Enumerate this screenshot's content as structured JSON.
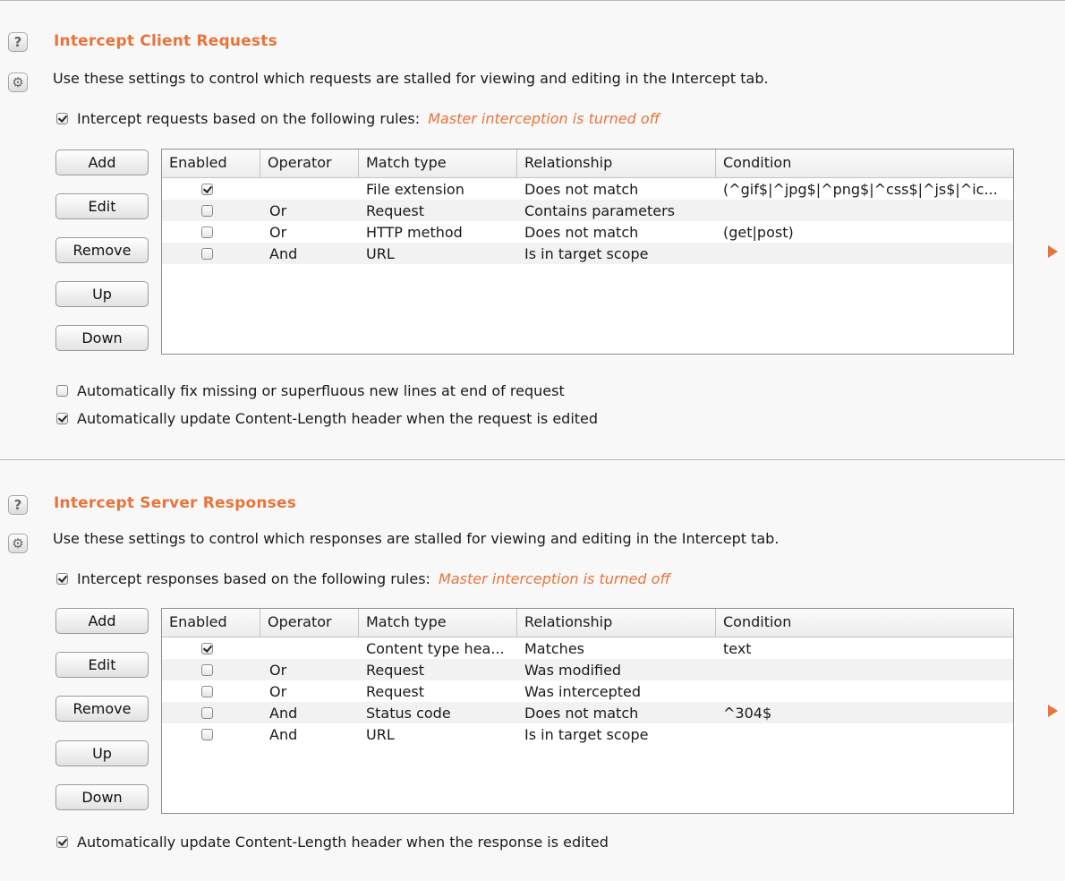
{
  "client": {
    "title": "Intercept Client Requests",
    "description": "Use these settings to control which requests are stalled for viewing and editing in the Intercept tab.",
    "master_label": "Intercept requests based on the following rules:",
    "master_checked": true,
    "master_status": "Master interception is turned off",
    "buttons": [
      "Add",
      "Edit",
      "Remove",
      "Up",
      "Down"
    ],
    "columns": [
      "Enabled",
      "Operator",
      "Match type",
      "Relationship",
      "Condition"
    ],
    "rows": [
      {
        "enabled": true,
        "operator": "",
        "match_type": "File extension",
        "relationship": "Does not match",
        "condition": "(^gif$|^jpg$|^png$|^css$|^js$|^ic..."
      },
      {
        "enabled": false,
        "operator": "Or",
        "match_type": "Request",
        "relationship": "Contains parameters",
        "condition": ""
      },
      {
        "enabled": false,
        "operator": "Or",
        "match_type": "HTTP method",
        "relationship": "Does not match",
        "condition": "(get|post)"
      },
      {
        "enabled": false,
        "operator": "And",
        "match_type": "URL",
        "relationship": "Is in target scope",
        "condition": ""
      }
    ],
    "options": [
      {
        "label": "Automatically fix missing or superfluous new lines at end of request",
        "checked": false
      },
      {
        "label": "Automatically update Content-Length header when the request is edited",
        "checked": true
      }
    ]
  },
  "server": {
    "title": "Intercept Server Responses",
    "description": "Use these settings to control which responses are stalled for viewing and editing in the Intercept tab.",
    "master_label": "Intercept responses based on the following rules:",
    "master_checked": true,
    "master_status": "Master interception is turned off",
    "buttons": [
      "Add",
      "Edit",
      "Remove",
      "Up",
      "Down"
    ],
    "columns": [
      "Enabled",
      "Operator",
      "Match type",
      "Relationship",
      "Condition"
    ],
    "rows": [
      {
        "enabled": true,
        "operator": "",
        "match_type": "Content type hea...",
        "relationship": "Matches",
        "condition": "text"
      },
      {
        "enabled": false,
        "operator": "Or",
        "match_type": "Request",
        "relationship": "Was modified",
        "condition": ""
      },
      {
        "enabled": false,
        "operator": "Or",
        "match_type": "Request",
        "relationship": "Was intercepted",
        "condition": ""
      },
      {
        "enabled": false,
        "operator": "And",
        "match_type": "Status code",
        "relationship": "Does not match",
        "condition": "^304$"
      },
      {
        "enabled": false,
        "operator": "And",
        "match_type": "URL",
        "relationship": "Is in target scope",
        "condition": ""
      }
    ],
    "options": [
      {
        "label": "Automatically update Content-Length header when the response is edited",
        "checked": true
      }
    ]
  },
  "icons": {
    "help": "help-icon",
    "settings": "gear-icon"
  },
  "colors": {
    "accent": "#e8743b",
    "background": "#f8f8f8"
  }
}
